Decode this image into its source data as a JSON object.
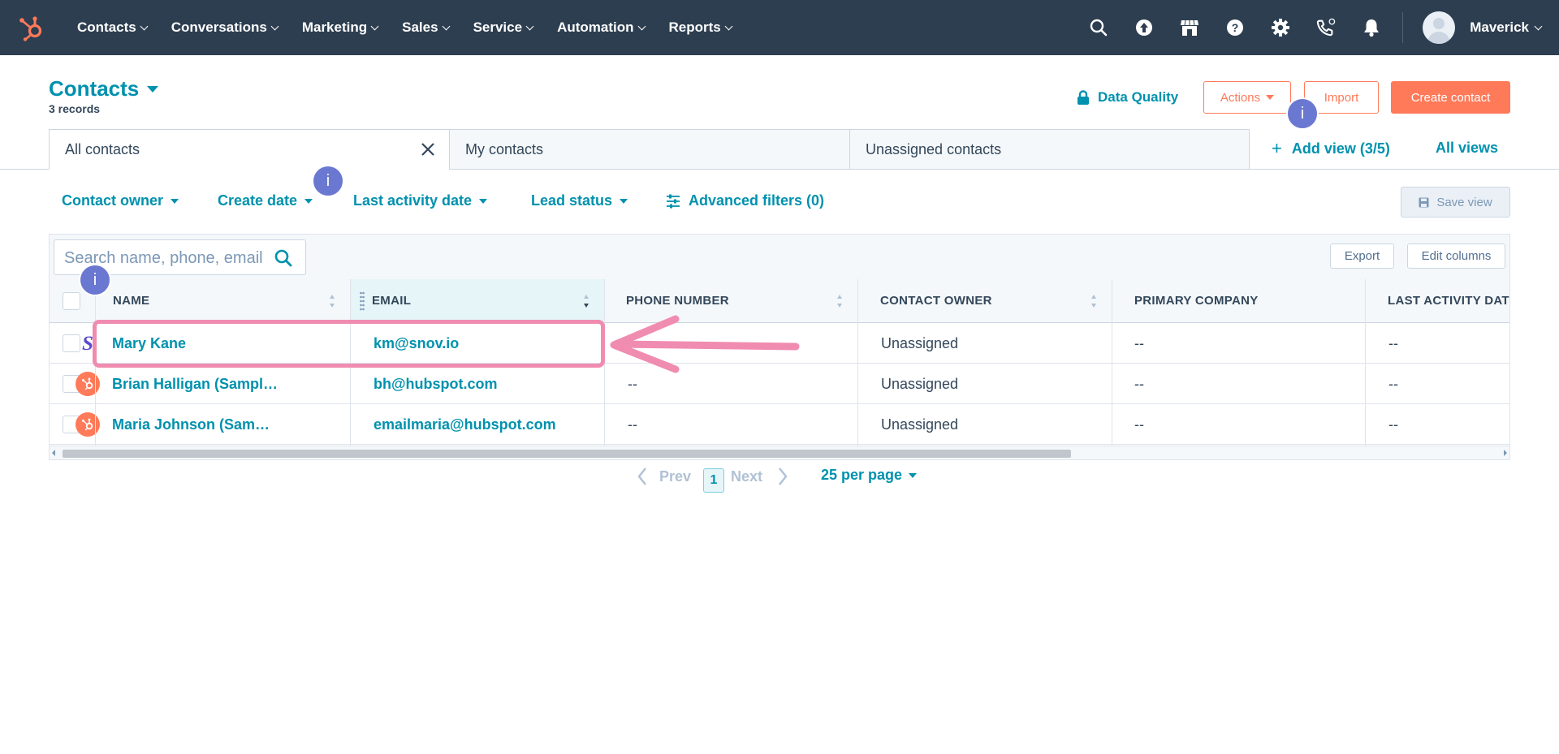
{
  "nav": {
    "items": [
      "Contacts",
      "Conversations",
      "Marketing",
      "Sales",
      "Service",
      "Automation",
      "Reports"
    ],
    "user_name": "Maverick",
    "icons": [
      "search-icon",
      "upgrade-icon",
      "marketplace-icon",
      "help-icon",
      "settings-icon",
      "calling-icon",
      "notifications-icon"
    ]
  },
  "header": {
    "title": "Contacts",
    "record_count": "3 records",
    "data_quality": "Data Quality",
    "actions_label": "Actions",
    "import_label": "Import",
    "create_label": "Create contact"
  },
  "tabs": {
    "items": [
      "All contacts",
      "My contacts",
      "Unassigned contacts"
    ],
    "active": "All contacts",
    "add_view": "Add view (3/5)",
    "all_views": "All views"
  },
  "filters": {
    "items": [
      "Contact owner",
      "Create date",
      "Last activity date",
      "Lead status"
    ],
    "advanced": "Advanced filters (0)",
    "save_view": "Save view"
  },
  "table": {
    "search_placeholder": "Search name, phone, email",
    "export_label": "Export",
    "edit_columns_label": "Edit columns",
    "columns": [
      "NAME",
      "EMAIL",
      "PHONE NUMBER",
      "CONTACT OWNER",
      "PRIMARY COMPANY",
      "LAST ACTIVITY DATE"
    ],
    "sorted_column": "EMAIL",
    "rows": [
      {
        "name": "Mary Kane",
        "email": "km@snov.io",
        "phone": "--",
        "owner": "Unassigned",
        "company": "--",
        "last_activity": "--",
        "avatar": "snov-logo-icon"
      },
      {
        "name": "Brian Halligan (Sample Contact)",
        "email": "bh@hubspot.com",
        "phone": "--",
        "owner": "Unassigned",
        "company": "--",
        "last_activity": "--",
        "avatar": "hubspot-logo-icon"
      },
      {
        "name": "Maria Johnson (Sample Contact)",
        "email": "emailmaria@hubspot.com",
        "phone": "--",
        "owner": "Unassigned",
        "company": "--",
        "last_activity": "--",
        "avatar": "hubspot-logo-icon"
      }
    ]
  },
  "pagination": {
    "prev": "Prev",
    "current": "1",
    "next": "Next",
    "per_page": "25 per page"
  },
  "info_badge": "i",
  "colors": {
    "nav_bg": "#2d3e50",
    "accent": "#0091ae",
    "orange": "#ff7a59",
    "info": "#6a78d1",
    "highlight": "#f08cb0"
  }
}
